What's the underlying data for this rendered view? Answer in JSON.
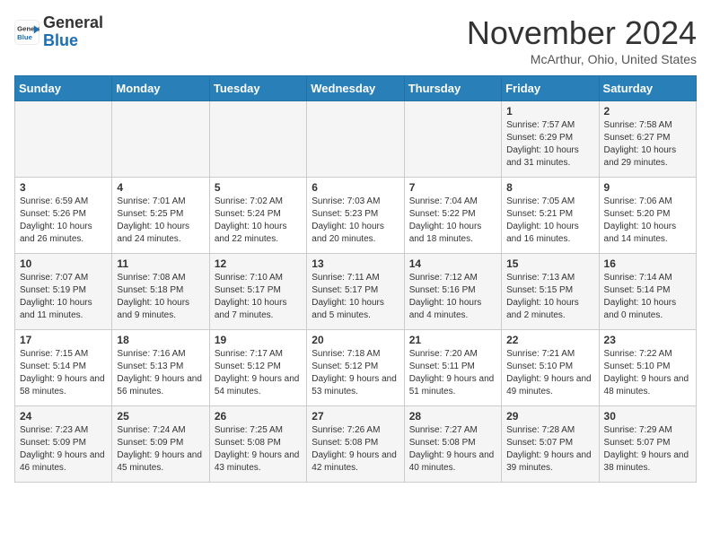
{
  "header": {
    "logo_line1": "General",
    "logo_line2": "Blue",
    "month": "November 2024",
    "location": "McArthur, Ohio, United States"
  },
  "weekdays": [
    "Sunday",
    "Monday",
    "Tuesday",
    "Wednesday",
    "Thursday",
    "Friday",
    "Saturday"
  ],
  "weeks": [
    [
      {
        "day": "",
        "info": ""
      },
      {
        "day": "",
        "info": ""
      },
      {
        "day": "",
        "info": ""
      },
      {
        "day": "",
        "info": ""
      },
      {
        "day": "",
        "info": ""
      },
      {
        "day": "1",
        "info": "Sunrise: 7:57 AM\nSunset: 6:29 PM\nDaylight: 10 hours and 31 minutes."
      },
      {
        "day": "2",
        "info": "Sunrise: 7:58 AM\nSunset: 6:27 PM\nDaylight: 10 hours and 29 minutes."
      }
    ],
    [
      {
        "day": "3",
        "info": "Sunrise: 6:59 AM\nSunset: 5:26 PM\nDaylight: 10 hours and 26 minutes."
      },
      {
        "day": "4",
        "info": "Sunrise: 7:01 AM\nSunset: 5:25 PM\nDaylight: 10 hours and 24 minutes."
      },
      {
        "day": "5",
        "info": "Sunrise: 7:02 AM\nSunset: 5:24 PM\nDaylight: 10 hours and 22 minutes."
      },
      {
        "day": "6",
        "info": "Sunrise: 7:03 AM\nSunset: 5:23 PM\nDaylight: 10 hours and 20 minutes."
      },
      {
        "day": "7",
        "info": "Sunrise: 7:04 AM\nSunset: 5:22 PM\nDaylight: 10 hours and 18 minutes."
      },
      {
        "day": "8",
        "info": "Sunrise: 7:05 AM\nSunset: 5:21 PM\nDaylight: 10 hours and 16 minutes."
      },
      {
        "day": "9",
        "info": "Sunrise: 7:06 AM\nSunset: 5:20 PM\nDaylight: 10 hours and 14 minutes."
      }
    ],
    [
      {
        "day": "10",
        "info": "Sunrise: 7:07 AM\nSunset: 5:19 PM\nDaylight: 10 hours and 11 minutes."
      },
      {
        "day": "11",
        "info": "Sunrise: 7:08 AM\nSunset: 5:18 PM\nDaylight: 10 hours and 9 minutes."
      },
      {
        "day": "12",
        "info": "Sunrise: 7:10 AM\nSunset: 5:17 PM\nDaylight: 10 hours and 7 minutes."
      },
      {
        "day": "13",
        "info": "Sunrise: 7:11 AM\nSunset: 5:17 PM\nDaylight: 10 hours and 5 minutes."
      },
      {
        "day": "14",
        "info": "Sunrise: 7:12 AM\nSunset: 5:16 PM\nDaylight: 10 hours and 4 minutes."
      },
      {
        "day": "15",
        "info": "Sunrise: 7:13 AM\nSunset: 5:15 PM\nDaylight: 10 hours and 2 minutes."
      },
      {
        "day": "16",
        "info": "Sunrise: 7:14 AM\nSunset: 5:14 PM\nDaylight: 10 hours and 0 minutes."
      }
    ],
    [
      {
        "day": "17",
        "info": "Sunrise: 7:15 AM\nSunset: 5:14 PM\nDaylight: 9 hours and 58 minutes."
      },
      {
        "day": "18",
        "info": "Sunrise: 7:16 AM\nSunset: 5:13 PM\nDaylight: 9 hours and 56 minutes."
      },
      {
        "day": "19",
        "info": "Sunrise: 7:17 AM\nSunset: 5:12 PM\nDaylight: 9 hours and 54 minutes."
      },
      {
        "day": "20",
        "info": "Sunrise: 7:18 AM\nSunset: 5:12 PM\nDaylight: 9 hours and 53 minutes."
      },
      {
        "day": "21",
        "info": "Sunrise: 7:20 AM\nSunset: 5:11 PM\nDaylight: 9 hours and 51 minutes."
      },
      {
        "day": "22",
        "info": "Sunrise: 7:21 AM\nSunset: 5:10 PM\nDaylight: 9 hours and 49 minutes."
      },
      {
        "day": "23",
        "info": "Sunrise: 7:22 AM\nSunset: 5:10 PM\nDaylight: 9 hours and 48 minutes."
      }
    ],
    [
      {
        "day": "24",
        "info": "Sunrise: 7:23 AM\nSunset: 5:09 PM\nDaylight: 9 hours and 46 minutes."
      },
      {
        "day": "25",
        "info": "Sunrise: 7:24 AM\nSunset: 5:09 PM\nDaylight: 9 hours and 45 minutes."
      },
      {
        "day": "26",
        "info": "Sunrise: 7:25 AM\nSunset: 5:08 PM\nDaylight: 9 hours and 43 minutes."
      },
      {
        "day": "27",
        "info": "Sunrise: 7:26 AM\nSunset: 5:08 PM\nDaylight: 9 hours and 42 minutes."
      },
      {
        "day": "28",
        "info": "Sunrise: 7:27 AM\nSunset: 5:08 PM\nDaylight: 9 hours and 40 minutes."
      },
      {
        "day": "29",
        "info": "Sunrise: 7:28 AM\nSunset: 5:07 PM\nDaylight: 9 hours and 39 minutes."
      },
      {
        "day": "30",
        "info": "Sunrise: 7:29 AM\nSunset: 5:07 PM\nDaylight: 9 hours and 38 minutes."
      }
    ]
  ]
}
